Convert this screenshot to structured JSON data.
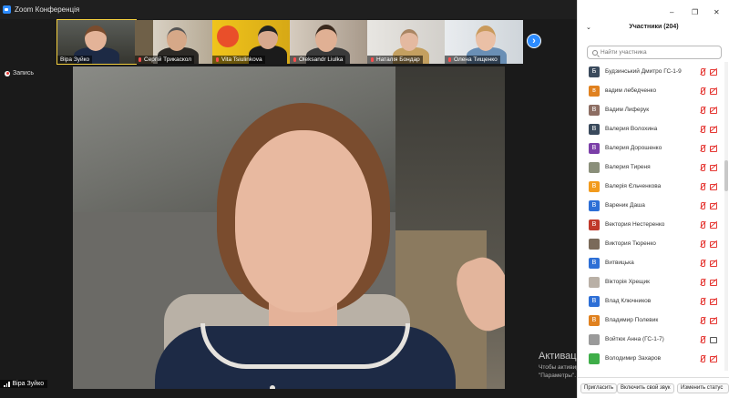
{
  "app": {
    "title": "Zoom Конференція"
  },
  "recording": {
    "label": "Запись"
  },
  "gallery": [
    {
      "name": "Віра Зуйко",
      "muted": false
    },
    {
      "name": "Сергій Трикаскол",
      "muted": true
    },
    {
      "name": "Vita Tsiulinkova",
      "muted": true
    },
    {
      "name": "Oleksandr Liulka",
      "muted": true
    },
    {
      "name": "Наталія Бондар",
      "muted": true
    },
    {
      "name": "Олена Тищенко",
      "muted": true
    }
  ],
  "active_speaker": {
    "name": "Віра Зуйко"
  },
  "watermark": {
    "title": "Активация Windows",
    "line1": "Чтобы активировать Windows, перейдите в раздел",
    "line2": "\"Параметры\"."
  },
  "participants_panel": {
    "header": "Участники (204)",
    "search_placeholder": "Найти участника",
    "participants": [
      {
        "initial": "Б",
        "name": "Будзинський Дмитро ГС-1-9",
        "color": "#3a4a5c",
        "cam_on": false
      },
      {
        "initial": "в",
        "name": "вадим лебедченко",
        "color": "#e0811f",
        "cam_on": false
      },
      {
        "initial": "В",
        "name": "Вадим Лиферук",
        "color": "#8d6e63",
        "cam_on": false
      },
      {
        "initial": "В",
        "name": "Валерия Волохина",
        "color": "#3a4a5c",
        "cam_on": false
      },
      {
        "initial": "В",
        "name": "Валерия Дорошенко",
        "color": "#7b3fa8",
        "cam_on": false
      },
      {
        "initial": "",
        "name": "Валерия Тиреня",
        "color": "#8a8f7a",
        "cam_on": false
      },
      {
        "initial": "В",
        "name": "Валерія Єльченкова",
        "color": "#f29b1d",
        "cam_on": false
      },
      {
        "initial": "В",
        "name": "Вареник Даша",
        "color": "#2d6fd6",
        "cam_on": false
      },
      {
        "initial": "В",
        "name": "Вектория Нестеренко",
        "color": "#c0392b",
        "cam_on": false
      },
      {
        "initial": "",
        "name": "Виктория Тюренко",
        "color": "#7a6a5a",
        "cam_on": false
      },
      {
        "initial": "В",
        "name": "Витвицька",
        "color": "#2d6fd6",
        "cam_on": false
      },
      {
        "initial": "",
        "name": "Вікторія Хрещик",
        "color": "#b9b0a6",
        "cam_on": false
      },
      {
        "initial": "В",
        "name": "Влад Ключников",
        "color": "#2d6fd6",
        "cam_on": false
      },
      {
        "initial": "В",
        "name": "Владимир Полевик",
        "color": "#e0811f",
        "cam_on": false
      },
      {
        "initial": "",
        "name": "Войтюк Анна (ГС-1-7)",
        "color": "#9a9a9a",
        "cam_on": true
      },
      {
        "initial": "",
        "name": "Володимир Захаров",
        "color": "#3fae49",
        "cam_on": false
      }
    ],
    "footer": {
      "invite": "Пригласить",
      "unmute_me": "Включить свой звук",
      "status": "Изменить статус"
    }
  }
}
